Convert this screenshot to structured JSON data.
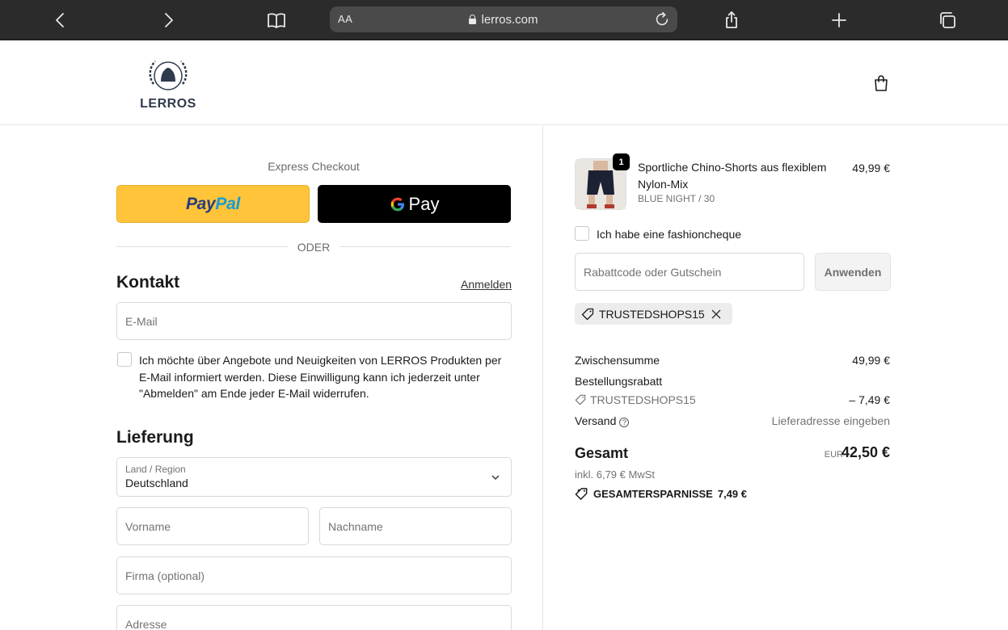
{
  "browser": {
    "url_aa": "AA",
    "url": "lerros.com"
  },
  "brand": {
    "logo_text": "LERROS"
  },
  "express": {
    "label": "Express Checkout",
    "paypal_part1": "Pay",
    "paypal_part2": "Pal",
    "gpay_label": "Pay",
    "divider": "ODER"
  },
  "contact": {
    "heading": "Kontakt",
    "login_link": "Anmelden",
    "email_placeholder": "E-Mail",
    "consent": "Ich möchte über Angebote und Neuigkeiten von LERROS Produkten per E-Mail informiert werden. Diese Einwilligung kann ich jederzeit unter \"Abmelden\" am Ende jeder E-Mail widerrufen."
  },
  "delivery": {
    "heading": "Lieferung",
    "country_label": "Land / Region",
    "country_value": "Deutschland",
    "firstname_placeholder": "Vorname",
    "lastname_placeholder": "Nachname",
    "company_placeholder": "Firma (optional)",
    "address_placeholder": "Adresse"
  },
  "order": {
    "item": {
      "quantity": "1",
      "title": "Sportliche Chino-Shorts aus flexiblem Nylon-Mix",
      "variant": "BLUE NIGHT / 30",
      "price": "49,99 €"
    },
    "fashioncheque_label": "Ich habe eine fashioncheque",
    "discount_placeholder": "Rabattcode oder Gutschein",
    "apply_label": "Anwenden",
    "applied_code": "TRUSTEDSHOPS15",
    "subtotal_label": "Zwischensumme",
    "subtotal_value": "49,99 €",
    "order_discount_label": "Bestellungsrabatt",
    "discount_code": "TRUSTEDSHOPS15",
    "discount_value": "– 7,49 €",
    "shipping_label": "Versand",
    "shipping_value": "Lieferadresse eingeben",
    "total_label": "Gesamt",
    "total_currency": "EUR",
    "total_value": "42,50 €",
    "tax_line": "inkl. 6,79 € MwSt",
    "savings_label": "GESAMTERSPARNISSE",
    "savings_value": "7,49 €"
  },
  "colors": {
    "paypal_yellow": "#ffc439",
    "paypal_dark_blue": "#253b80",
    "paypal_light_blue": "#179bd7",
    "gpay_black": "#000000",
    "browser_bar": "#2b2b2b"
  },
  "icons": [
    "back-icon",
    "forward-icon",
    "bookmarks-icon",
    "lock-icon",
    "reload-icon",
    "share-icon",
    "new-tab-icon",
    "tabs-icon",
    "cart-icon",
    "chevron-down-icon",
    "tag-icon",
    "close-icon",
    "help-icon",
    "savings-tag-icon"
  ]
}
